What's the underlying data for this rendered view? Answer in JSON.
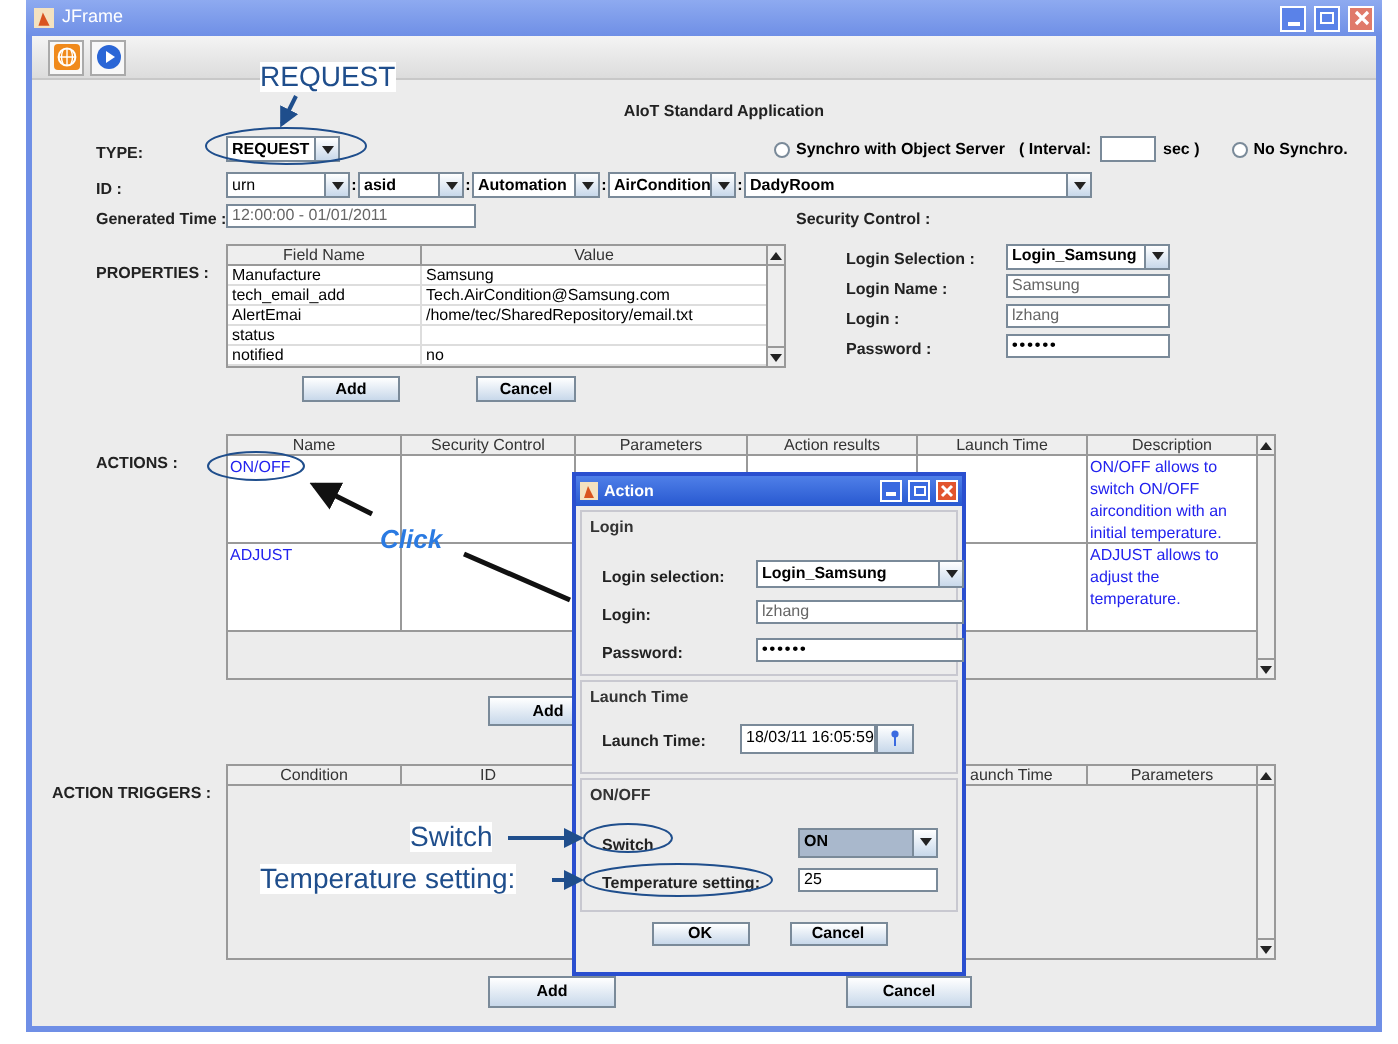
{
  "window": {
    "title": "JFrame"
  },
  "app_title": "AIoT Standard Application",
  "type": {
    "label": "TYPE:",
    "value": "REQUEST"
  },
  "sync": {
    "synchro": {
      "label": "Synchro with Object Server",
      "selected": false
    },
    "interval_label": "( Interval:",
    "unit": "sec )",
    "no_synchro": {
      "label": "No Synchro.",
      "selected": false
    }
  },
  "id": {
    "label": "ID :",
    "parts": [
      {
        "value": "urn"
      },
      {
        "separator": ":",
        "value": "asid"
      },
      {
        "separator": ":",
        "value": "Automation"
      },
      {
        "separator": ":",
        "value": "AirCondition"
      },
      {
        "separator": ":",
        "value": "DadyRoom"
      }
    ]
  },
  "generated_time": {
    "label": "Generated Time :",
    "value": "12:00:00 - 01/01/2011"
  },
  "properties": {
    "label": "PROPERTIES :",
    "columns": [
      "Field Name",
      "Value"
    ],
    "rows": [
      [
        "Manufacture",
        "Samsung"
      ],
      [
        "tech_email_add",
        "Tech.AirCondition@Samsung.com"
      ],
      [
        "AlertEmai",
        "/home/tec/SharedRepository/email.txt"
      ],
      [
        "status",
        ""
      ],
      [
        "notified",
        "no"
      ]
    ],
    "buttons": [
      "Add",
      "Cancel"
    ]
  },
  "security_control": {
    "title": "Security Control :",
    "login_selection": {
      "label": "Login Selection :",
      "value": "Login_Samsung"
    },
    "fields": [
      {
        "label": "Login Name :",
        "value": "Samsung",
        "kind": "text"
      },
      {
        "label": "Login :",
        "value": "lzhang",
        "kind": "text"
      },
      {
        "label": "Password :",
        "value": "••••••",
        "kind": "password"
      }
    ]
  },
  "actions": {
    "label": "ACTIONS :",
    "columns": [
      "Name",
      "Security Control",
      "Parameters",
      "Action results",
      "Launch Time",
      "Description"
    ],
    "rows": [
      {
        "name": "ON/OFF",
        "description": "ON/OFF allows to switch ON/OFF aircondition with an initial temperature."
      },
      {
        "name": "ADJUST",
        "description": "ADJUST allows to adjust the temperature."
      }
    ],
    "buttons": [
      "Add"
    ]
  },
  "action_triggers": {
    "label": "ACTION TRIGGERS :",
    "columns": [
      "Condition",
      "ID",
      "aunch Time",
      "Parameters"
    ],
    "buttons": [
      "Add",
      "Cancel"
    ]
  },
  "dialog": {
    "title": "Action",
    "groups": [
      {
        "title": "Login",
        "fields": [
          {
            "kind": "combo",
            "label": "Login selection:",
            "value": "Login_Samsung"
          },
          {
            "kind": "text",
            "label": "Login:",
            "value": "lzhang"
          },
          {
            "kind": "password",
            "label": "Password:",
            "value": "••••••"
          }
        ]
      },
      {
        "title": "Launch Time",
        "fields": [
          {
            "kind": "date",
            "label": "Launch Time:",
            "value": "18/03/11 16:05:59"
          }
        ]
      },
      {
        "title": "ON/OFF",
        "fields": [
          {
            "kind": "combo",
            "label": "Switch",
            "value": "ON"
          },
          {
            "kind": "text",
            "label": "Temperature setting:",
            "value": "25"
          }
        ]
      }
    ],
    "buttons": [
      "OK",
      "Cancel"
    ]
  },
  "annotations": [
    {
      "kind": "request",
      "text": "REQUEST"
    },
    {
      "kind": "click",
      "text": "Click"
    },
    {
      "kind": "switch",
      "text": "Switch"
    },
    {
      "kind": "temperature",
      "text": "Temperature setting:"
    }
  ]
}
